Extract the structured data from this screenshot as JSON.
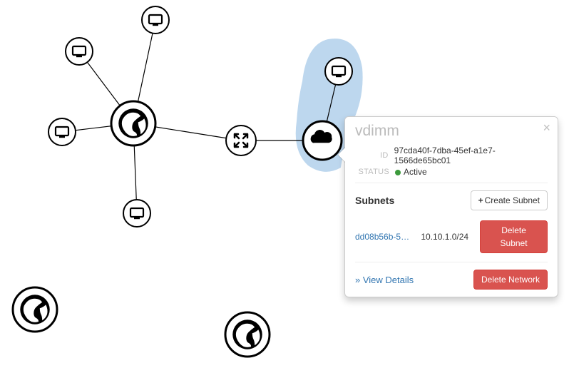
{
  "popover": {
    "title": "vdimm",
    "close_glyph": "×",
    "id_label": "ID",
    "id_value": "97cda40f-7dba-45ef-a1e7-1566de65bc01",
    "status_label": "STATUS",
    "status_value": "Active",
    "subnets_heading": "Subnets",
    "create_subnet_label": "Create Subnet",
    "plus_glyph": "+",
    "subnet_name": "dd08b56b-53…",
    "subnet_cidr": "10.10.1.0/24",
    "delete_subnet_label": "Delete Subnet",
    "view_details_label": "» View Details",
    "delete_network_label": "Delete Network"
  }
}
